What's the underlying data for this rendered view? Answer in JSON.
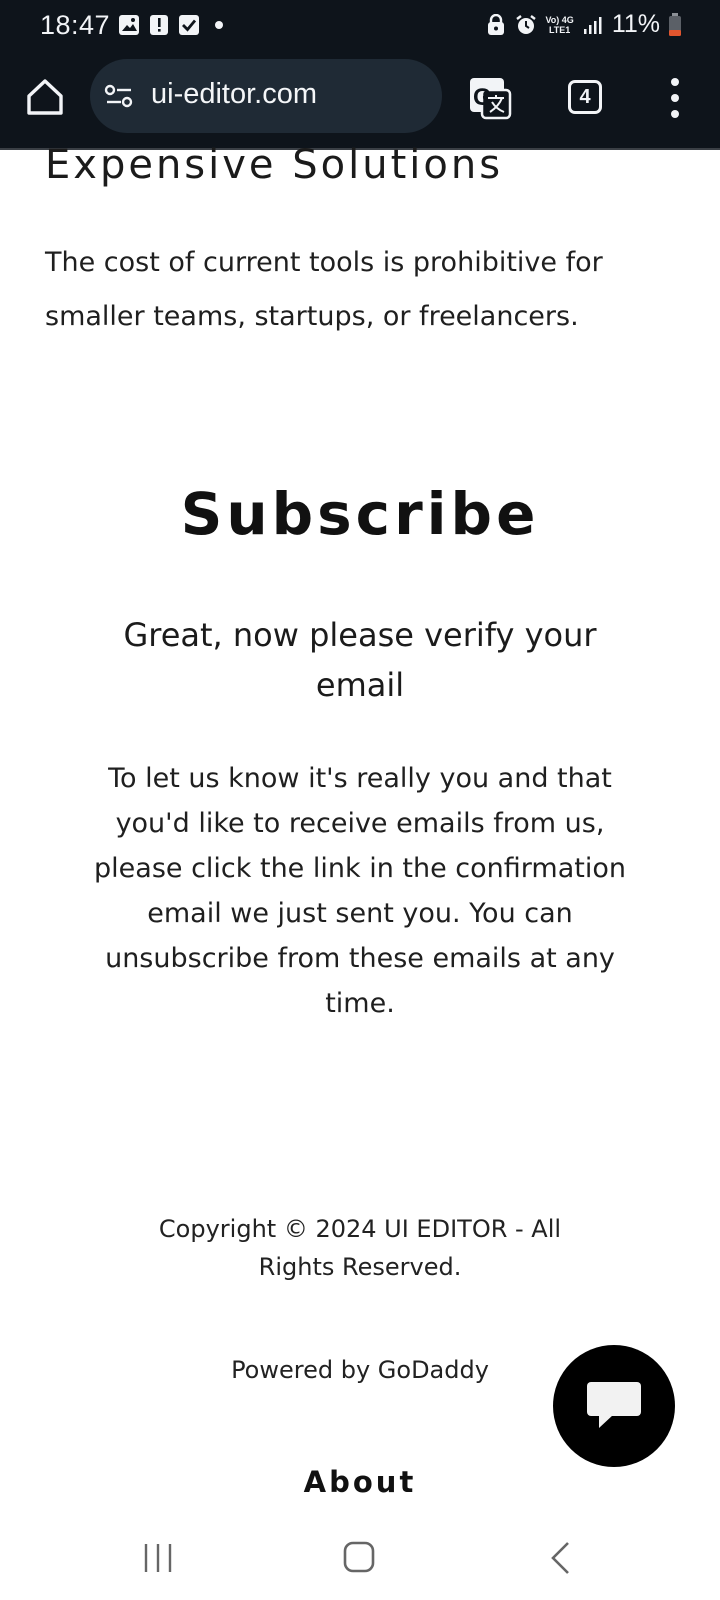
{
  "status_bar": {
    "time": "18:47",
    "network_label_top": "Vo) 4G",
    "network_label_bottom": "LTE1",
    "battery_percent": "11%",
    "left_icons": [
      "image-icon",
      "alert-icon",
      "checkbox-icon",
      "dot-icon"
    ],
    "right_icons": [
      "lock-icon",
      "alarm-icon",
      "signal-icon",
      "battery-icon"
    ]
  },
  "browser": {
    "url": "ui-editor.com",
    "tab_count": "4"
  },
  "content": {
    "section_heading": "Expensive Solutions",
    "section_body": "The cost of current tools is prohibitive for smaller teams, startups, or freelancers.",
    "subscribe_title": "Subscribe",
    "verify_heading": "Great, now please verify your email",
    "verify_body": "To let us know it's really you and that you'd like to receive emails from us, please click the link in the confirmation email we just sent you. You can unsubscribe from these emails at any time.",
    "copyright": "Copyright © 2024 UI EDITOR - All Rights Reserved.",
    "powered_by": "Powered by GoDaddy",
    "about_label": "About"
  },
  "colors": {
    "top_bar_bg": "#0e141b",
    "url_box_bg": "#1f2a35",
    "battery_low": "#e2552e",
    "fab_bg": "#000000"
  }
}
